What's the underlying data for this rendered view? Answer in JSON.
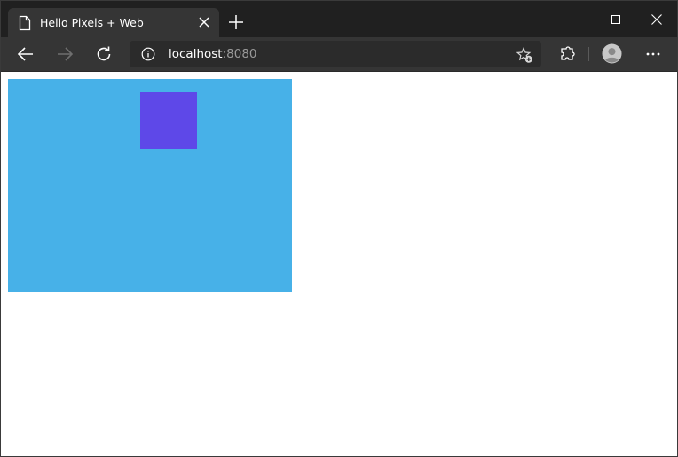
{
  "tab": {
    "title": "Hello Pixels + Web",
    "icon": "page-icon"
  },
  "toolbar": {
    "url_host": "localhost",
    "url_port": ":8080"
  },
  "page": {
    "canvas_color": "#47b1e8",
    "square_color": "#5e48e8"
  },
  "theme": {
    "titlebar_bg": "#202020",
    "toolbar_bg": "#353535",
    "omnibox_bg": "#2b2b2b"
  }
}
